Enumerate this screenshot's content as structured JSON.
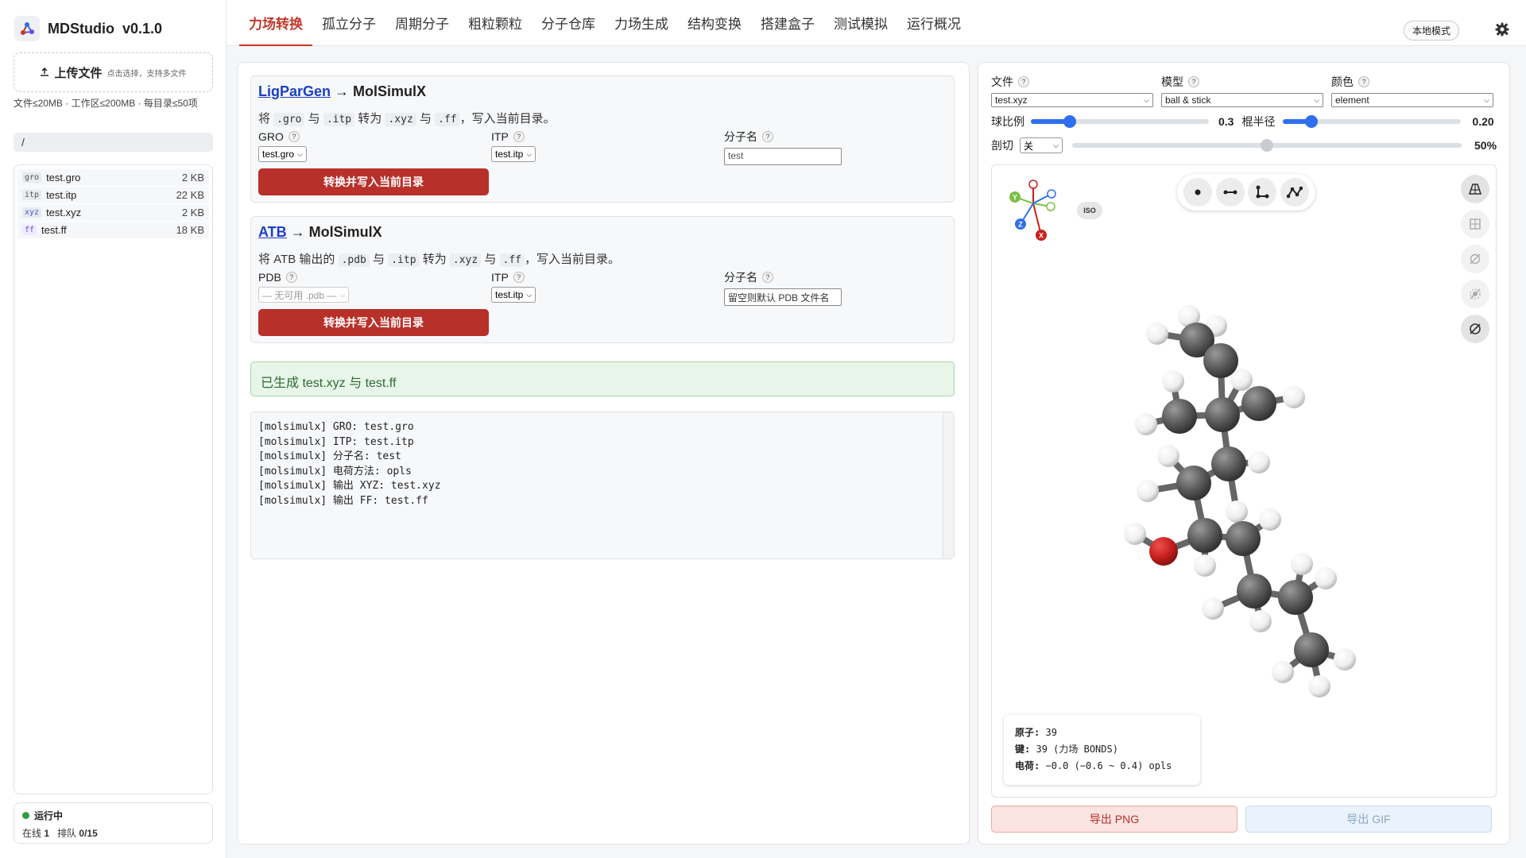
{
  "app": {
    "name": "MDStudio",
    "version": "v0.1.0"
  },
  "sidebar": {
    "upload_label": "上传文件",
    "upload_hint": "点击选择，支持多文件",
    "limits": "文件≤20MB · 工作区≤200MB · 每目录≤50项",
    "path": "/",
    "files": [
      {
        "ext": "gro",
        "name": "test.gro",
        "size": "2 KB"
      },
      {
        "ext": "itp",
        "name": "test.itp",
        "size": "22 KB"
      },
      {
        "ext": "xyz",
        "name": "test.xyz",
        "size": "2 KB"
      },
      {
        "ext": "ff",
        "name": "test.ff",
        "size": "18 KB"
      }
    ],
    "status": {
      "state": "运行中",
      "online_label": "在线",
      "online": "1",
      "queue_label": "排队",
      "queue": "0/15"
    }
  },
  "tabs": [
    "力场转换",
    "孤立分子",
    "周期分子",
    "粗粒颗粒",
    "分子仓库",
    "力场生成",
    "结构变换",
    "搭建盒子",
    "测试模拟",
    "运行概况"
  ],
  "active_tab": 0,
  "mode_label": "本地模式",
  "ligpargen": {
    "title_link": "LigParGen",
    "title_rest": " → MolSimulX",
    "desc_parts": [
      "将 ",
      ".gro",
      " 与 ",
      ".itp",
      " 转为 ",
      ".xyz",
      " 与 ",
      ".ff",
      "，写入当前目录。"
    ],
    "gro_label": "GRO",
    "gro_value": "test.gro",
    "itp_label": "ITP",
    "itp_value": "test.itp",
    "name_label": "分子名",
    "name_value": "test",
    "button": "转换并写入当前目录"
  },
  "atb": {
    "title_link": "ATB",
    "title_rest": " → MolSimulX",
    "desc_parts": [
      "将 ATB 输出的 ",
      ".pdb",
      " 与 ",
      ".itp",
      " 转为 ",
      ".xyz",
      " 与 ",
      ".ff",
      "，写入当前目录。"
    ],
    "pdb_label": "PDB",
    "pdb_value": "— 无可用 .pdb —",
    "itp_label": "ITP",
    "itp_value": "test.itp",
    "name_label": "分子名",
    "name_placeholder": "留空则默认 PDB 文件名",
    "button": "转换并写入当前目录"
  },
  "success_message": "已生成 test.xyz 与 test.ff",
  "log_lines": [
    "[molsimulx] GRO: test.gro",
    "[molsimulx] ITP: test.itp",
    "[molsimulx] 分子名: test",
    "[molsimulx] 电荷方法: opls",
    "[molsimulx] 输出 XYZ: test.xyz",
    "[molsimulx] 输出 FF: test.ff"
  ],
  "viewer": {
    "file_label": "文件",
    "file_value": "test.xyz",
    "model_label": "模型",
    "model_value": "ball & stick",
    "color_label": "颜色",
    "color_value": "element",
    "ball_label": "球比例",
    "ball_value": "0.3",
    "ball_fraction": 0.22,
    "stick_label": "棍半径",
    "stick_value": "0.20",
    "stick_fraction": 0.16,
    "clip_label": "剖切",
    "clip_value": "关",
    "clip_percent": "50%",
    "clip_fraction": 0.5,
    "iso_label": "ISO",
    "axes": {
      "x": "X",
      "y": "Y",
      "z": "Z"
    },
    "stats": {
      "atoms_label": "原子:",
      "atoms": "39",
      "bonds_label": "键:",
      "bonds": "39 (力场 BONDS)",
      "charge_label": "电荷:",
      "charge": "−0.0 (−0.6 ~ 0.4) opls"
    },
    "export_png": "导出 PNG",
    "export_gif": "导出 GIF",
    "colors": {
      "carbon": "#5a5a5a",
      "hydrogen": "#f4f4f4",
      "oxygen": "#c81f1f",
      "accent": "#b8302a"
    }
  }
}
